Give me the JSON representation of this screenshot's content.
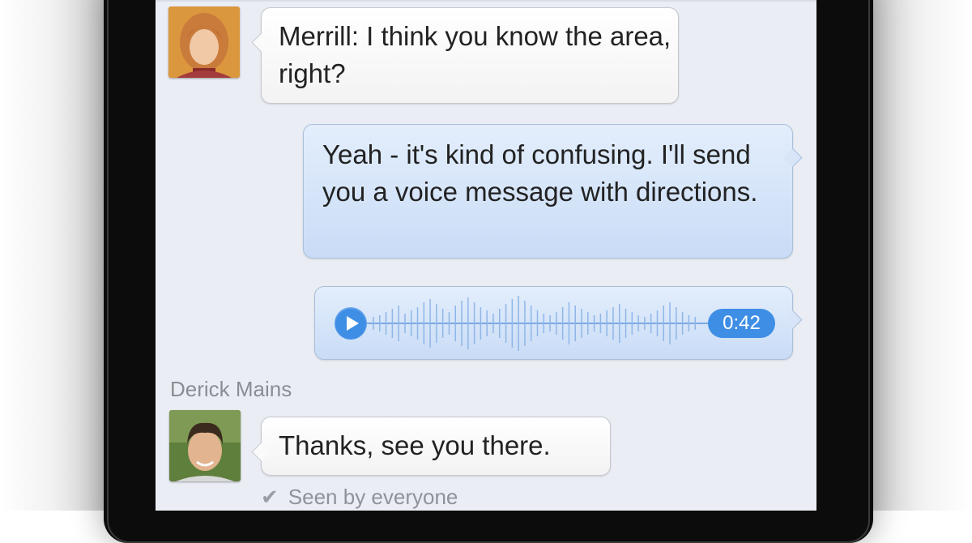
{
  "conversation": {
    "messages": [
      {
        "direction": "incoming",
        "text": "Merrill: I think you know the area, right?"
      },
      {
        "direction": "outgoing",
        "text": "Yeah - it's kind of confusing. I'll send you a voice message with directions."
      },
      {
        "direction": "outgoing",
        "type": "voice",
        "duration": "0:42"
      },
      {
        "direction": "incoming",
        "sender": "Derick Mains",
        "text": "Thanks, see you there."
      }
    ],
    "status": "Seen by everyone"
  },
  "icons": {
    "play": "play-icon",
    "check": "check-icon",
    "waveform": "waveform-icon"
  },
  "colors": {
    "screen_background": "#eaedf4",
    "incoming_bubble": "#ffffff",
    "outgoing_bubble": "#c9dcf6",
    "voice_accent": "#3f8ee6",
    "meta_text": "#8a8d93"
  }
}
